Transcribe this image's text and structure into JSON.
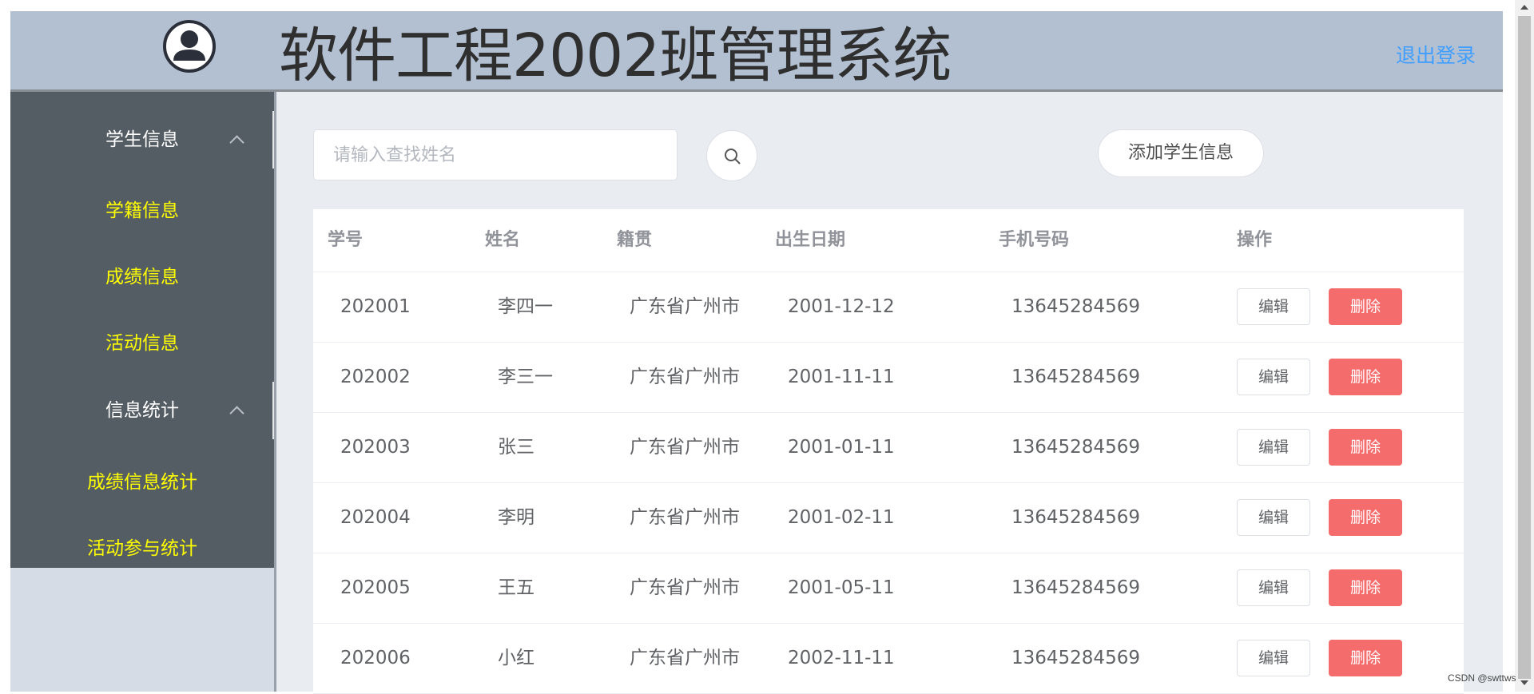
{
  "header": {
    "title": "软件工程2002班管理系统",
    "logout_label": "退出登录"
  },
  "sidebar": {
    "groups": [
      {
        "title": "学生信息",
        "items": [
          "学籍信息",
          "成绩信息",
          "活动信息"
        ]
      },
      {
        "title": "信息统计",
        "items": [
          "成绩信息统计",
          "活动参与统计"
        ]
      }
    ]
  },
  "toolbar": {
    "search_placeholder": "请输入查找姓名",
    "add_label": "添加学生信息"
  },
  "table": {
    "columns": [
      "学号",
      "姓名",
      "籍贯",
      "出生日期",
      "手机号码",
      "操作"
    ],
    "rows": [
      {
        "id": "202001",
        "name": "李四一",
        "origin": "广东省广州市",
        "birth": "2001-12-12",
        "phone": "13645284569"
      },
      {
        "id": "202002",
        "name": "李三一",
        "origin": "广东省广州市",
        "birth": "2001-11-11",
        "phone": "13645284569"
      },
      {
        "id": "202003",
        "name": "张三",
        "origin": "广东省广州市",
        "birth": "2001-01-11",
        "phone": "13645284569"
      },
      {
        "id": "202004",
        "name": "李明",
        "origin": "广东省广州市",
        "birth": "2001-02-11",
        "phone": "13645284569"
      },
      {
        "id": "202005",
        "name": "王五",
        "origin": "广东省广州市",
        "birth": "2001-05-11",
        "phone": "13645284569"
      },
      {
        "id": "202006",
        "name": "小红",
        "origin": "广东省广州市",
        "birth": "2002-11-11",
        "phone": "13645284569"
      }
    ],
    "edit_label": "编辑",
    "delete_label": "删除"
  },
  "watermark": "CSDN @swttws",
  "colors": {
    "header_bg": "#b3c0d1",
    "sidebar_bg": "#545c64",
    "nav_item_text": "#ffff00",
    "link_blue": "#409eff",
    "danger": "#f56c6c"
  }
}
